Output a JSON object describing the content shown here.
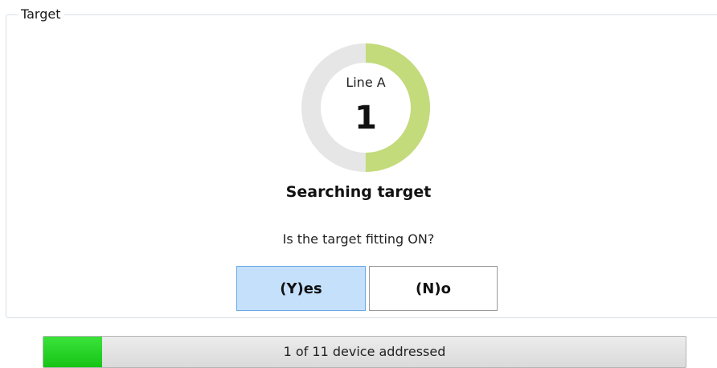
{
  "target_group": {
    "title": "Target"
  },
  "ring": {
    "line_label": "Line A",
    "number": "1",
    "progress_fraction": 0.5,
    "colors": {
      "track": "#e6e6e6",
      "fill": "#c3db7a"
    }
  },
  "status": {
    "text": "Searching target"
  },
  "question": {
    "text": "Is the target fitting ON?"
  },
  "buttons": {
    "yes_label": "(Y)es",
    "no_label": "(N)o"
  },
  "progress": {
    "text": "1 of 11 device addressed",
    "current": 1,
    "total": 11,
    "fill_color": "#22cc22"
  }
}
